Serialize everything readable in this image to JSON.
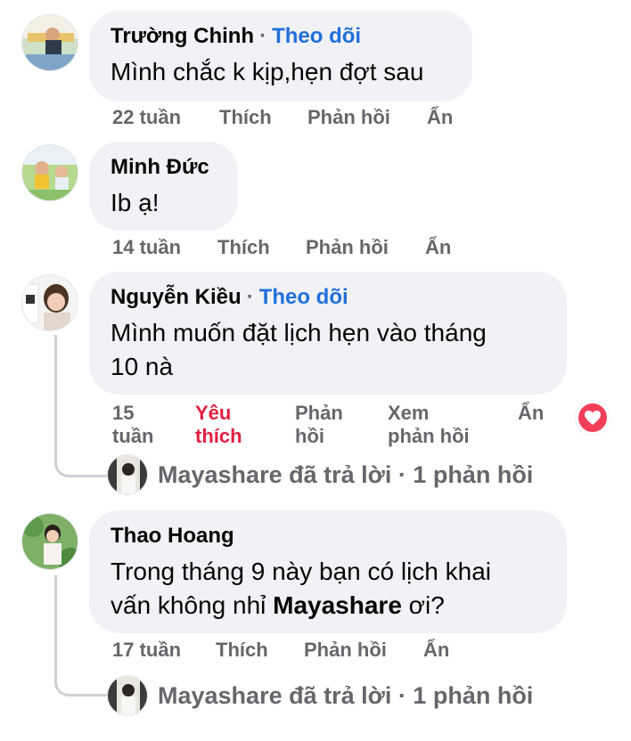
{
  "comments": [
    {
      "author": "Trường Chinh",
      "follow": "Theo dõi",
      "text": "Mình chắc k kịp,hẹn đợt sau",
      "time": "22 tuần",
      "like": "Thích",
      "reply": "Phản hồi",
      "hide": "Ẩn"
    },
    {
      "author": "Minh Đức",
      "text": "Ib ạ!",
      "time": "14 tuần",
      "like": "Thích",
      "reply": "Phản hồi",
      "hide": "Ẩn"
    },
    {
      "author": "Nguyễn Kiều",
      "follow": "Theo dõi",
      "text_line1": "Mình muốn đặt lịch hẹn vào tháng",
      "text_line2": "10 nà",
      "time_line1": "15",
      "time_line2": "tuần",
      "like_line1": "Yêu",
      "like_line2": "thích",
      "reply_line1": "Phản",
      "reply_line2": "hồi",
      "view_line1": "Xem",
      "view_line2": "phản hồi",
      "hide": "Ẩn",
      "reaction": "heart-icon",
      "replies_summary": "Mayashare đã trả lời · 1 phản hồi"
    },
    {
      "author": "Thao Hoang",
      "text_line1": "Trong tháng 9 này bạn có lịch khai",
      "text_line2_prefix": "vấn không nhỉ ",
      "mention": "Mayashare",
      "text_line2_suffix": " ơi?",
      "time": "17 tuần",
      "like": "Thích",
      "reply": "Phản hồi",
      "hide": "Ẩn",
      "replies_summary": "Mayashare đã trả lời · 1 phản hồi"
    }
  ],
  "colors": {
    "bubble": "#f0f2f5",
    "link": "#216fdb",
    "muted": "#65676b",
    "liked": "#e41e3f",
    "reaction_heart": "#f33e58"
  }
}
